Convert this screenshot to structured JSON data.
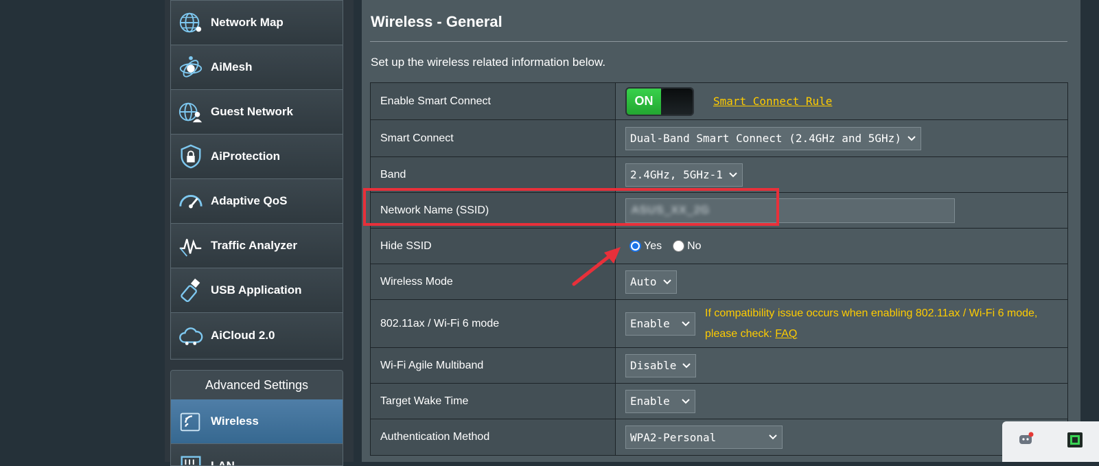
{
  "sidebar": {
    "items": [
      {
        "label": "Network Map",
        "icon": "network-map-icon"
      },
      {
        "label": "AiMesh",
        "icon": "aimesh-icon"
      },
      {
        "label": "Guest Network",
        "icon": "guest-network-icon"
      },
      {
        "label": "AiProtection",
        "icon": "aiprotection-icon"
      },
      {
        "label": "Adaptive QoS",
        "icon": "adaptive-qos-icon"
      },
      {
        "label": "Traffic Analyzer",
        "icon": "traffic-analyzer-icon"
      },
      {
        "label": "USB Application",
        "icon": "usb-application-icon"
      },
      {
        "label": "AiCloud 2.0",
        "icon": "aicloud-icon"
      }
    ],
    "advanced": {
      "title": "Advanced Settings",
      "items": [
        {
          "label": "Wireless",
          "icon": "wireless-icon",
          "active": true
        },
        {
          "label": "LAN",
          "icon": "lan-icon",
          "active": false
        }
      ]
    }
  },
  "main": {
    "title": "Wireless - General",
    "description": "Set up the wireless related information below.",
    "rows": {
      "smart_connect_enable": {
        "label": "Enable Smart Connect",
        "toggle": "ON",
        "link": "Smart Connect Rule"
      },
      "smart_connect": {
        "label": "Smart Connect",
        "value": "Dual-Band Smart Connect (2.4GHz and 5GHz)"
      },
      "band": {
        "label": "Band",
        "value": "2.4GHz, 5GHz-1"
      },
      "ssid": {
        "label": "Network Name (SSID)",
        "value": "ASUS_XX_2G"
      },
      "hide_ssid": {
        "label": "Hide SSID",
        "yes": "Yes",
        "no": "No",
        "selected": "Yes"
      },
      "wireless_mode": {
        "label": "Wireless Mode",
        "value": "Auto"
      },
      "wifi6": {
        "label": "802.11ax / Wi-Fi 6 mode",
        "value": "Enable",
        "note_line1": "If compatibility issue occurs when enabling 802.11ax / Wi-Fi 6 mode,",
        "note_line2": "please check: ",
        "note_link": "FAQ"
      },
      "agile_multiband": {
        "label": "Wi-Fi Agile Multiband",
        "value": "Disable"
      },
      "twt": {
        "label": "Target Wake Time",
        "value": "Enable"
      },
      "auth_method": {
        "label": "Authentication Method",
        "value": "WPA2-Personal"
      }
    }
  },
  "colors": {
    "accent_yellow": "#ffcc00",
    "highlight_red": "#e8303a",
    "toggle_green": "#2fbd3e",
    "active_blue": "#4679a3"
  }
}
